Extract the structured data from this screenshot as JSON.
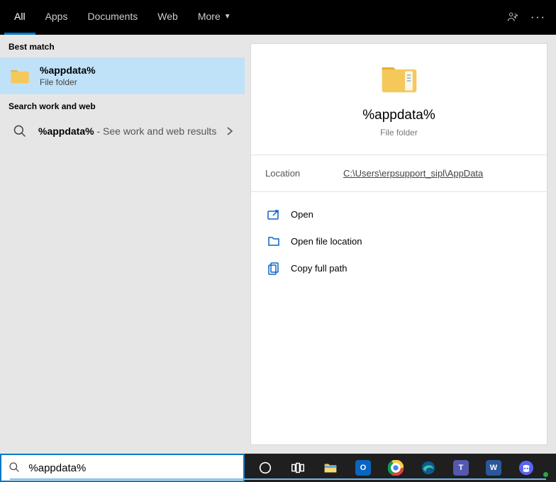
{
  "topbar": {
    "tabs": [
      "All",
      "Apps",
      "Documents",
      "Web",
      "More"
    ]
  },
  "left": {
    "best_match_label": "Best match",
    "best_match": {
      "title": "%appdata%",
      "subtitle": "File folder"
    },
    "web_label": "Search work and web",
    "web_result": {
      "query": "%appdata%",
      "suffix": " - See work and web results"
    }
  },
  "detail": {
    "title": "%appdata%",
    "subtitle": "File folder",
    "location_label": "Location",
    "location_value": "C:\\Users\\erpsupport_sipl\\AppData",
    "actions": {
      "open": "Open",
      "open_loc": "Open file location",
      "copy_path": "Copy full path"
    }
  },
  "search": {
    "value": "%appdata%"
  }
}
